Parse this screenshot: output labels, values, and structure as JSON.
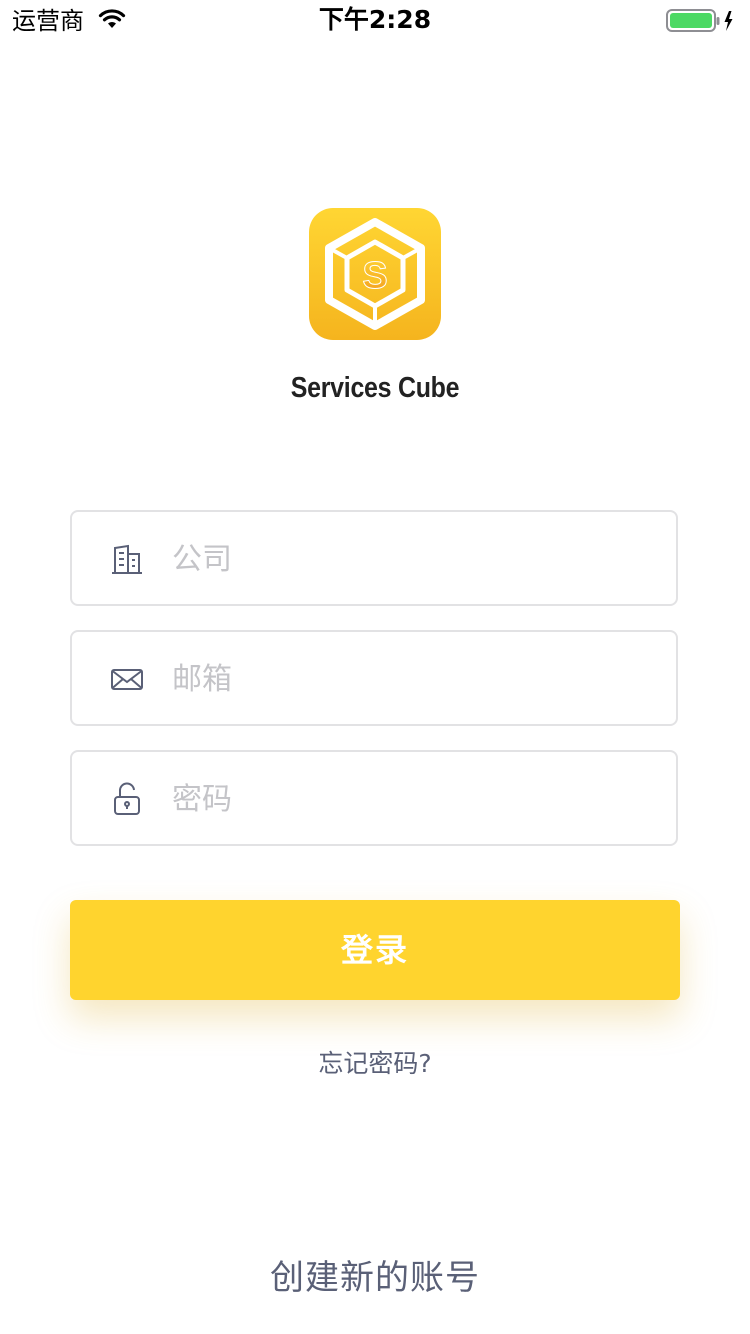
{
  "status_bar": {
    "carrier": "运营商",
    "time": "下午2:28",
    "icons": [
      "wifi-icon",
      "battery-icon",
      "charging-bolt-icon"
    ],
    "battery_color": "#4cd964"
  },
  "branding": {
    "logo_letter": "S",
    "logo_icon": "hexagon-cube-icon",
    "app_name": "Services Cube",
    "logo_color": "#ffd42e"
  },
  "form": {
    "company": {
      "placeholder": "公司",
      "value": "",
      "icon": "building-icon"
    },
    "email": {
      "placeholder": "邮箱",
      "value": "",
      "icon": "envelope-icon"
    },
    "password": {
      "placeholder": "密码",
      "value": "",
      "icon": "unlock-icon"
    }
  },
  "actions": {
    "login_label": "登录",
    "forgot_label": "忘记密码?",
    "create_account_label": "创建新的账号",
    "accent_color": "#ffd42e"
  }
}
